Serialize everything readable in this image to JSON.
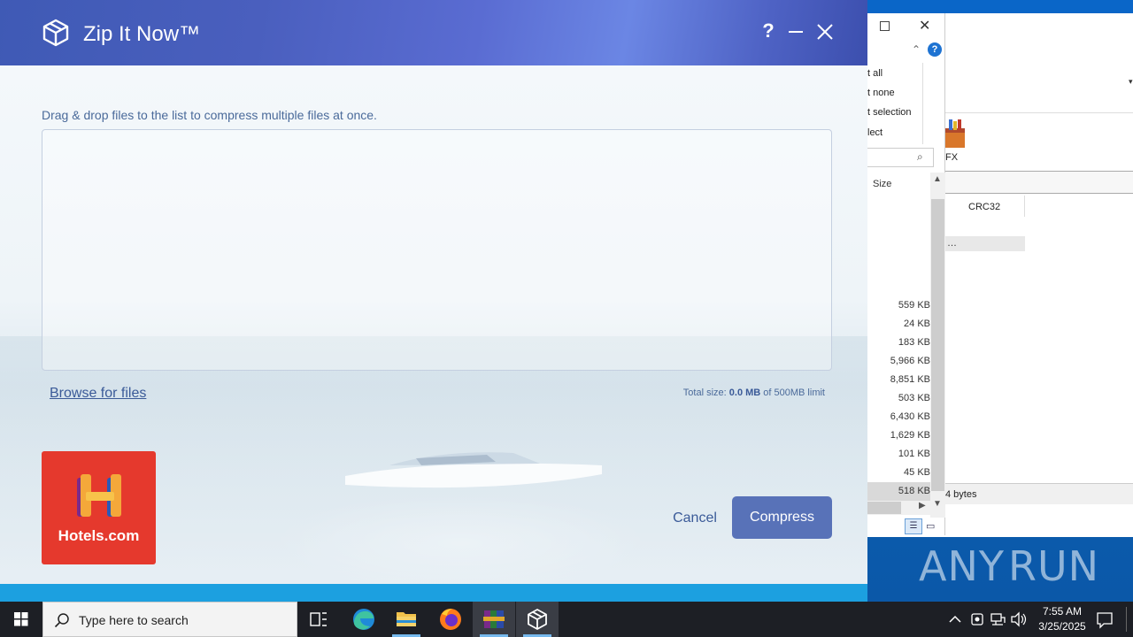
{
  "dialog": {
    "title": "Zip It Now™",
    "help_label": "?",
    "instruction": "Drag & drop files to the list to compress multiple files at once.",
    "browse_label": "Browse for files",
    "total_size_prefix": "Total size:",
    "total_size_value": "0.0 MB",
    "total_size_suffix": "of 500MB limit",
    "ad_brand": "Hotels.com",
    "cancel_label": "Cancel",
    "compress_label": "Compress"
  },
  "background_window": {
    "menu": [
      "t all",
      "t none",
      "t selection",
      "lect"
    ],
    "size_header": "Size",
    "sizes": [
      "559 KB",
      "24 KB",
      "183 KB",
      "5,966 KB",
      "8,851 KB",
      "503 KB",
      "6,430 KB",
      "1,629 KB",
      "101 KB",
      "45 KB",
      "518 KB"
    ],
    "sfx_label": "FX",
    "crc_header": "CRC32",
    "row_text": "…",
    "status_text": "4 bytes"
  },
  "desktop": {
    "watermark_left": "ANY",
    "watermark_right": "RUN"
  },
  "taskbar": {
    "search_placeholder": "Type here to search",
    "time": "7:55 AM",
    "date": "3/25/2025"
  },
  "colors": {
    "title_gradient_start": "#3f5ab5",
    "title_gradient_mid": "#6b86e4",
    "accent_button": "#5872b8",
    "link": "#3a5a98",
    "footer_strip": "#1ca0e0",
    "ad_red": "#e5392d"
  }
}
